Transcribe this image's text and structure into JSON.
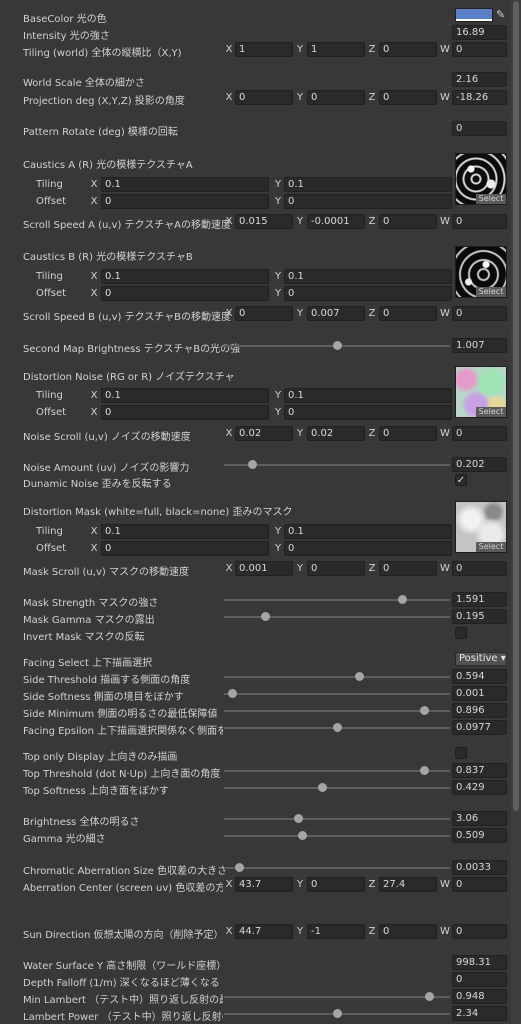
{
  "panel": {
    "base_color": {
      "label": "BaseColor 光の色",
      "color": "#5a7fc6"
    },
    "intensity": {
      "label": "Intensity 光の強さ",
      "value": "16.89"
    },
    "tiling_world": {
      "label": "Tiling (world)  全体の縦横比（X,Y)",
      "x": "1",
      "y": "1",
      "z": "0",
      "w": "0"
    },
    "world_scale": {
      "label": "World Scale  全体の細かさ",
      "value": "2.16"
    },
    "projection": {
      "label": "Projection deg (X,Y,Z)  投影の角度",
      "x": "0",
      "y": "0",
      "z": "0",
      "w": "-18.26"
    },
    "pattern_rotate": {
      "label": "Pattern Rotate (deg)  模様の回転",
      "value": "0"
    },
    "caustics_a": {
      "label": "Caustics A (R)  光の模様テクスチャA",
      "tiling_label": "Tiling",
      "tiling_x": "0.1",
      "tiling_y": "0.1",
      "offset_label": "Offset",
      "offset_x": "0",
      "offset_y": "0",
      "select_label": "Select"
    },
    "scroll_a": {
      "label": "Scroll Speed A (u,v)  テクスチャAの移動速度",
      "x": "0.015",
      "y": "-0.0001",
      "z": "0",
      "w": "0"
    },
    "caustics_b": {
      "label": "Caustics B (R)  光の模様テクスチャB",
      "tiling_label": "Tiling",
      "tiling_x": "0.1",
      "tiling_y": "0.1",
      "offset_label": "Offset",
      "offset_x": "0",
      "offset_y": "0",
      "select_label": "Select"
    },
    "scroll_b": {
      "label": "Scroll Speed B (u,v)  テクスチャBの移動速度",
      "x": "0",
      "y": "0.007",
      "z": "0",
      "w": "0"
    },
    "second_brightness": {
      "label": "Second Map Brightness  テクスチャBの光の強",
      "value": "1.007",
      "level": 0.5
    },
    "distortion_noise": {
      "label": "Distortion Noise (RG or R)  ノイズテクスチャ",
      "tiling_label": "Tiling",
      "tiling_x": "0.1",
      "tiling_y": "0.1",
      "offset_label": "Offset",
      "offset_x": "0",
      "offset_y": "0",
      "select_label": "Select"
    },
    "noise_scroll": {
      "label": "Noise Scroll (u,v)  ノイズの移動速度",
      "x": "0.02",
      "y": "0.02",
      "z": "0",
      "w": "0"
    },
    "noise_amount": {
      "label": "Noise Amount (uv)  ノイズの影響力",
      "value": "0.202",
      "level": 0.11
    },
    "dynamic_noise": {
      "label": "Dunamic Noise  歪みを反転する",
      "checked": "✓"
    },
    "distortion_mask": {
      "label": "Distortion Mask (white=full, black=none)  歪みのマスク",
      "tiling_label": "Tiling",
      "tiling_x": "0.1",
      "tiling_y": "0.1",
      "offset_label": "Offset",
      "offset_x": "0",
      "offset_y": "0",
      "select_label": "Select"
    },
    "mask_scroll": {
      "label": "Mask Scroll (u,v)  マスクの移動速度",
      "x": "0.001",
      "y": "0",
      "z": "0",
      "w": "0"
    },
    "mask_strength": {
      "label": "Mask Strength  マスクの強さ",
      "value": "1.591",
      "level": 0.8
    },
    "mask_gamma": {
      "label": "Mask Gamma  マスクの露出",
      "value": "0.195",
      "level": 0.17
    },
    "invert_mask": {
      "label": "Invert Mask  マスクの反転",
      "checked": ""
    },
    "facing_select": {
      "label": "Facing Select  上下描画選択",
      "value": "Positive ▾"
    },
    "side_threshold": {
      "label": "Side Threshold  描画する側面の角度",
      "value": "0.594",
      "level": 0.6
    },
    "side_softness": {
      "label": "Side Softness  側面の境目をぼかす",
      "value": "0.001",
      "level": 0.02
    },
    "side_minimum": {
      "label": "Side Minimum  側面の明るさの最低保障値",
      "value": "0.896",
      "level": 0.9
    },
    "facing_epsilon": {
      "label": "Facing Epsilon  上下描画選択関係なく側面を",
      "value": "0.0977",
      "level": 0.5
    },
    "top_only": {
      "label": "Top only Display  上向きのみ描画",
      "checked": ""
    },
    "top_threshold": {
      "label": "Top Threshold (dot N·Up)  上向き面の角度",
      "value": "0.837",
      "level": 0.9
    },
    "top_softness": {
      "label": "Top Softness  上向き面をぼかす",
      "value": "0.429",
      "level": 0.43
    },
    "brightness": {
      "label": "Brightness  全体の明るさ",
      "value": "3.06",
      "level": 0.32
    },
    "gamma": {
      "label": "Gamma  光の細さ",
      "value": "0.509",
      "level": 0.34
    },
    "chromatic_size": {
      "label": "Chromatic Aberration Size  色収差の大きさ",
      "value": "0.0033",
      "level": 0.05
    },
    "aberration_center": {
      "label": "Aberration Center (screen uv)  色収差の方向",
      "x": "43.7",
      "y": "0",
      "z": "27.4",
      "w": "0"
    },
    "sun_direction": {
      "label": "Sun Direction 仮想太陽の方向（削除予定）",
      "x": "44.7",
      "y": "-1",
      "z": "0",
      "w": "0"
    },
    "water_surface": {
      "label": "Water Surface Y   高さ制限（ワールド座標）",
      "value": "998.31"
    },
    "depth_falloff": {
      "label": "Depth Falloff (1/m)  深くなるほど薄くなる",
      "value": "0"
    },
    "min_lambert": {
      "label": "Min Lambert  （テスト中）照り返し反射の最小",
      "value": "0.948",
      "level": 0.92
    },
    "lambert_power": {
      "label": "Lambert Power  （テスト中）照り返し反射の強",
      "value": "2.34",
      "level": 0.5
    }
  },
  "axis_labels": {
    "x": "X",
    "y": "Y",
    "z": "Z",
    "w": "W"
  }
}
